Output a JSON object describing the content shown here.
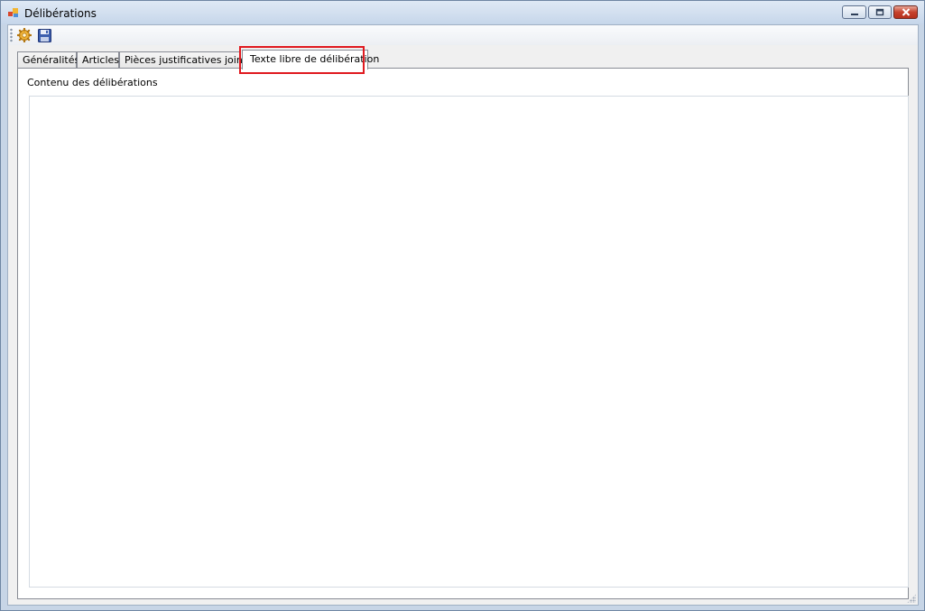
{
  "window": {
    "title": "Délibérations"
  },
  "toolbar": {
    "buttons": [
      {
        "name": "settings-button",
        "icon": "gear-icon"
      },
      {
        "name": "save-button",
        "icon": "floppy-disk-icon"
      }
    ]
  },
  "tabs": [
    {
      "label": "Généralités",
      "active": false
    },
    {
      "label": "Articles",
      "active": false
    },
    {
      "label": "Pièces justificatives jointes",
      "active": false
    },
    {
      "label": "Texte libre de délibération",
      "active": true
    }
  ],
  "panel": {
    "label": "Contenu des délibérations",
    "content": ""
  },
  "colors": {
    "highlight": "#e0191f",
    "title_bar": "#c6d6ea",
    "client_bg": "#f0f0f0"
  }
}
